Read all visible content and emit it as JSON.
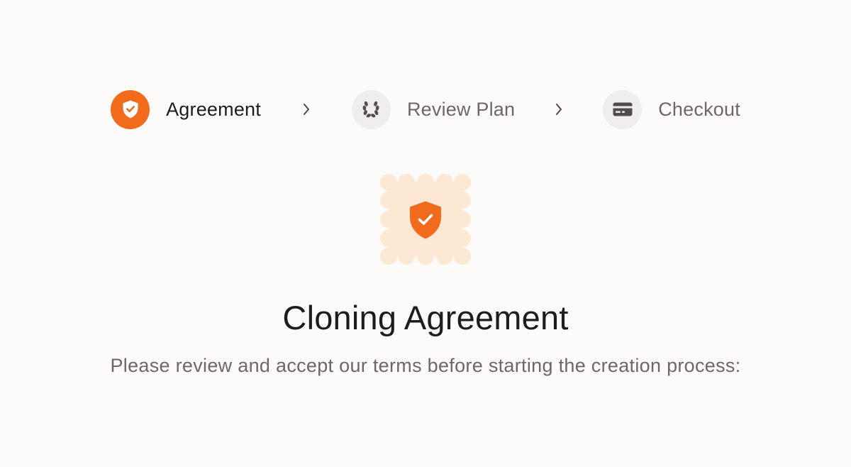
{
  "stepper": {
    "steps": [
      {
        "label": "Agreement",
        "icon": "shield-check-icon",
        "state": "active"
      },
      {
        "label": "Review Plan",
        "icon": "laurel-wreath-icon",
        "state": "inactive"
      },
      {
        "label": "Checkout",
        "icon": "credit-card-icon",
        "state": "inactive"
      }
    ],
    "separator_icon": "chevron-right-icon"
  },
  "hero": {
    "icon": "shield-check-icon",
    "badge_shape": "scalloped-square"
  },
  "content": {
    "title": "Cloning Agreement",
    "subtitle": "Please review and accept our terms before starting the creation process:"
  },
  "colors": {
    "accent": "#f26b1d",
    "accent_soft": "#fde9d3",
    "background": "#fcfbf9",
    "inactive_circle": "#efeeec",
    "text_primary": "#1f1d1b",
    "text_secondary": "#6b6866"
  }
}
